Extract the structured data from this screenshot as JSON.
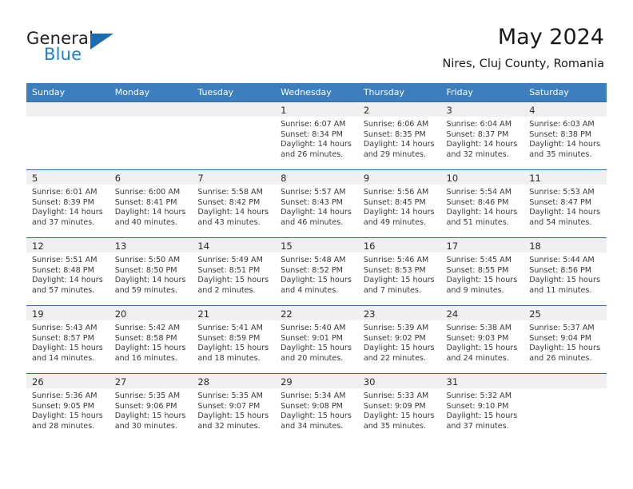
{
  "brand": {
    "name_part1": "General",
    "name_part2": "Blue",
    "flag_icon": "triangle-flag-icon"
  },
  "header": {
    "title": "May 2024",
    "location": "Nires, Cluj County, Romania"
  },
  "calendar": {
    "weekday_headers": [
      "Sunday",
      "Monday",
      "Tuesday",
      "Wednesday",
      "Thursday",
      "Friday",
      "Saturday"
    ],
    "colors": {
      "header_blue": "#3d7ebf",
      "row_divider_blue": "#2f6fb0",
      "daynum_band": "#f0f0f0",
      "brand_blue": "#1b7fd4"
    },
    "weeks": [
      [
        {
          "day": "",
          "sunrise": "",
          "sunset": "",
          "daylight1": "",
          "daylight2": ""
        },
        {
          "day": "",
          "sunrise": "",
          "sunset": "",
          "daylight1": "",
          "daylight2": ""
        },
        {
          "day": "",
          "sunrise": "",
          "sunset": "",
          "daylight1": "",
          "daylight2": ""
        },
        {
          "day": "1",
          "sunrise": "Sunrise: 6:07 AM",
          "sunset": "Sunset: 8:34 PM",
          "daylight1": "Daylight: 14 hours",
          "daylight2": "and 26 minutes."
        },
        {
          "day": "2",
          "sunrise": "Sunrise: 6:06 AM",
          "sunset": "Sunset: 8:35 PM",
          "daylight1": "Daylight: 14 hours",
          "daylight2": "and 29 minutes."
        },
        {
          "day": "3",
          "sunrise": "Sunrise: 6:04 AM",
          "sunset": "Sunset: 8:37 PM",
          "daylight1": "Daylight: 14 hours",
          "daylight2": "and 32 minutes."
        },
        {
          "day": "4",
          "sunrise": "Sunrise: 6:03 AM",
          "sunset": "Sunset: 8:38 PM",
          "daylight1": "Daylight: 14 hours",
          "daylight2": "and 35 minutes."
        }
      ],
      [
        {
          "day": "5",
          "sunrise": "Sunrise: 6:01 AM",
          "sunset": "Sunset: 8:39 PM",
          "daylight1": "Daylight: 14 hours",
          "daylight2": "and 37 minutes."
        },
        {
          "day": "6",
          "sunrise": "Sunrise: 6:00 AM",
          "sunset": "Sunset: 8:41 PM",
          "daylight1": "Daylight: 14 hours",
          "daylight2": "and 40 minutes."
        },
        {
          "day": "7",
          "sunrise": "Sunrise: 5:58 AM",
          "sunset": "Sunset: 8:42 PM",
          "daylight1": "Daylight: 14 hours",
          "daylight2": "and 43 minutes."
        },
        {
          "day": "8",
          "sunrise": "Sunrise: 5:57 AM",
          "sunset": "Sunset: 8:43 PM",
          "daylight1": "Daylight: 14 hours",
          "daylight2": "and 46 minutes."
        },
        {
          "day": "9",
          "sunrise": "Sunrise: 5:56 AM",
          "sunset": "Sunset: 8:45 PM",
          "daylight1": "Daylight: 14 hours",
          "daylight2": "and 49 minutes."
        },
        {
          "day": "10",
          "sunrise": "Sunrise: 5:54 AM",
          "sunset": "Sunset: 8:46 PM",
          "daylight1": "Daylight: 14 hours",
          "daylight2": "and 51 minutes."
        },
        {
          "day": "11",
          "sunrise": "Sunrise: 5:53 AM",
          "sunset": "Sunset: 8:47 PM",
          "daylight1": "Daylight: 14 hours",
          "daylight2": "and 54 minutes."
        }
      ],
      [
        {
          "day": "12",
          "sunrise": "Sunrise: 5:51 AM",
          "sunset": "Sunset: 8:48 PM",
          "daylight1": "Daylight: 14 hours",
          "daylight2": "and 57 minutes."
        },
        {
          "day": "13",
          "sunrise": "Sunrise: 5:50 AM",
          "sunset": "Sunset: 8:50 PM",
          "daylight1": "Daylight: 14 hours",
          "daylight2": "and 59 minutes."
        },
        {
          "day": "14",
          "sunrise": "Sunrise: 5:49 AM",
          "sunset": "Sunset: 8:51 PM",
          "daylight1": "Daylight: 15 hours",
          "daylight2": "and 2 minutes."
        },
        {
          "day": "15",
          "sunrise": "Sunrise: 5:48 AM",
          "sunset": "Sunset: 8:52 PM",
          "daylight1": "Daylight: 15 hours",
          "daylight2": "and 4 minutes."
        },
        {
          "day": "16",
          "sunrise": "Sunrise: 5:46 AM",
          "sunset": "Sunset: 8:53 PM",
          "daylight1": "Daylight: 15 hours",
          "daylight2": "and 7 minutes."
        },
        {
          "day": "17",
          "sunrise": "Sunrise: 5:45 AM",
          "sunset": "Sunset: 8:55 PM",
          "daylight1": "Daylight: 15 hours",
          "daylight2": "and 9 minutes."
        },
        {
          "day": "18",
          "sunrise": "Sunrise: 5:44 AM",
          "sunset": "Sunset: 8:56 PM",
          "daylight1": "Daylight: 15 hours",
          "daylight2": "and 11 minutes."
        }
      ],
      [
        {
          "day": "19",
          "sunrise": "Sunrise: 5:43 AM",
          "sunset": "Sunset: 8:57 PM",
          "daylight1": "Daylight: 15 hours",
          "daylight2": "and 14 minutes."
        },
        {
          "day": "20",
          "sunrise": "Sunrise: 5:42 AM",
          "sunset": "Sunset: 8:58 PM",
          "daylight1": "Daylight: 15 hours",
          "daylight2": "and 16 minutes."
        },
        {
          "day": "21",
          "sunrise": "Sunrise: 5:41 AM",
          "sunset": "Sunset: 8:59 PM",
          "daylight1": "Daylight: 15 hours",
          "daylight2": "and 18 minutes."
        },
        {
          "day": "22",
          "sunrise": "Sunrise: 5:40 AM",
          "sunset": "Sunset: 9:01 PM",
          "daylight1": "Daylight: 15 hours",
          "daylight2": "and 20 minutes."
        },
        {
          "day": "23",
          "sunrise": "Sunrise: 5:39 AM",
          "sunset": "Sunset: 9:02 PM",
          "daylight1": "Daylight: 15 hours",
          "daylight2": "and 22 minutes."
        },
        {
          "day": "24",
          "sunrise": "Sunrise: 5:38 AM",
          "sunset": "Sunset: 9:03 PM",
          "daylight1": "Daylight: 15 hours",
          "daylight2": "and 24 minutes."
        },
        {
          "day": "25",
          "sunrise": "Sunrise: 5:37 AM",
          "sunset": "Sunset: 9:04 PM",
          "daylight1": "Daylight: 15 hours",
          "daylight2": "and 26 minutes."
        }
      ],
      [
        {
          "day": "26",
          "sunrise": "Sunrise: 5:36 AM",
          "sunset": "Sunset: 9:05 PM",
          "daylight1": "Daylight: 15 hours",
          "daylight2": "and 28 minutes."
        },
        {
          "day": "27",
          "sunrise": "Sunrise: 5:35 AM",
          "sunset": "Sunset: 9:06 PM",
          "daylight1": "Daylight: 15 hours",
          "daylight2": "and 30 minutes."
        },
        {
          "day": "28",
          "sunrise": "Sunrise: 5:35 AM",
          "sunset": "Sunset: 9:07 PM",
          "daylight1": "Daylight: 15 hours",
          "daylight2": "and 32 minutes."
        },
        {
          "day": "29",
          "sunrise": "Sunrise: 5:34 AM",
          "sunset": "Sunset: 9:08 PM",
          "daylight1": "Daylight: 15 hours",
          "daylight2": "and 34 minutes."
        },
        {
          "day": "30",
          "sunrise": "Sunrise: 5:33 AM",
          "sunset": "Sunset: 9:09 PM",
          "daylight1": "Daylight: 15 hours",
          "daylight2": "and 35 minutes."
        },
        {
          "day": "31",
          "sunrise": "Sunrise: 5:32 AM",
          "sunset": "Sunset: 9:10 PM",
          "daylight1": "Daylight: 15 hours",
          "daylight2": "and 37 minutes."
        },
        {
          "day": "",
          "sunrise": "",
          "sunset": "",
          "daylight1": "",
          "daylight2": ""
        }
      ]
    ]
  }
}
